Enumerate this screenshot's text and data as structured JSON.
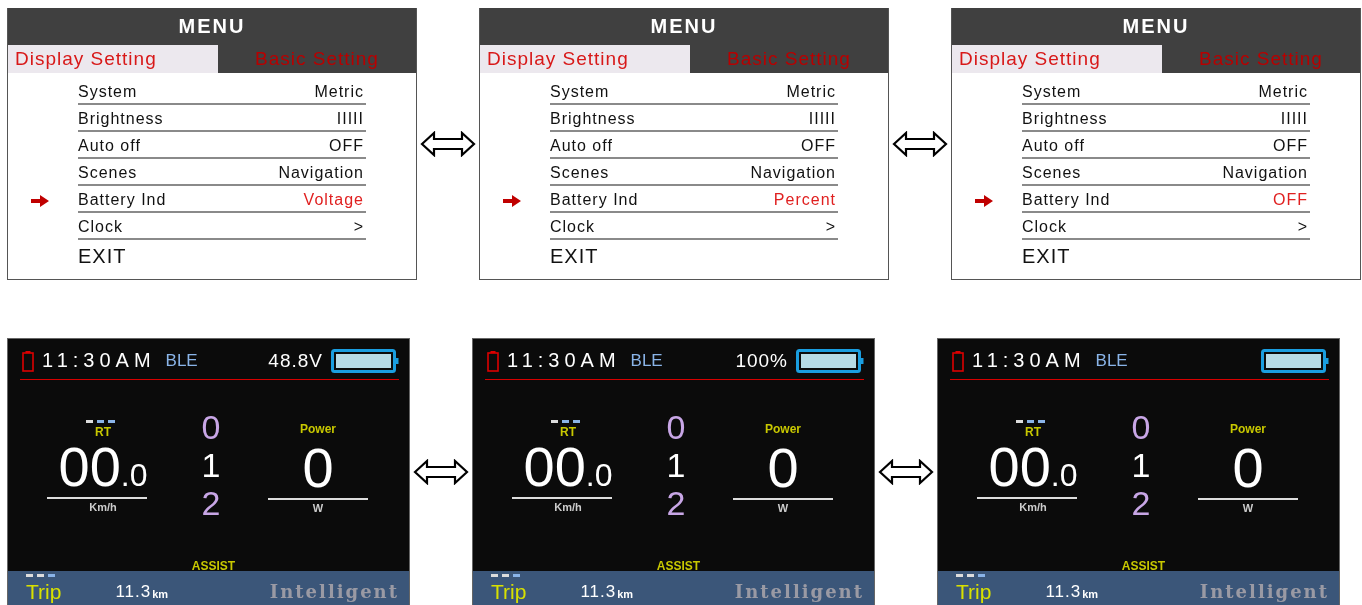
{
  "menus": [
    {
      "title": "MENU",
      "tabs": [
        {
          "label": "Display Setting",
          "selected": true
        },
        {
          "label": "Basic Setting",
          "selected": false
        }
      ],
      "items": [
        {
          "label": "System",
          "value": "Metric",
          "selected": false
        },
        {
          "label": "Brightness",
          "value": "IIIII",
          "selected": false
        },
        {
          "label": "Auto off",
          "value": "OFF",
          "selected": false
        },
        {
          "label": "Scenes",
          "value": "Navigation",
          "selected": false
        },
        {
          "label": "Battery Ind",
          "value": "Voltage",
          "selected": true
        },
        {
          "label": "Clock",
          "value": ">",
          "selected": false
        }
      ],
      "exit": "EXIT"
    },
    {
      "title": "MENU",
      "tabs": [
        {
          "label": "Display Setting",
          "selected": true
        },
        {
          "label": "Basic Setting",
          "selected": false
        }
      ],
      "items": [
        {
          "label": "System",
          "value": "Metric",
          "selected": false
        },
        {
          "label": "Brightness",
          "value": "IIIII",
          "selected": false
        },
        {
          "label": "Auto off",
          "value": "OFF",
          "selected": false
        },
        {
          "label": "Scenes",
          "value": "Navigation",
          "selected": false
        },
        {
          "label": "Battery Ind",
          "value": "Percent",
          "selected": true
        },
        {
          "label": "Clock",
          "value": ">",
          "selected": false
        }
      ],
      "exit": "EXIT"
    },
    {
      "title": "MENU",
      "tabs": [
        {
          "label": "Display Setting",
          "selected": true
        },
        {
          "label": "Basic Setting",
          "selected": false
        }
      ],
      "items": [
        {
          "label": "System",
          "value": "Metric",
          "selected": false
        },
        {
          "label": "Brightness",
          "value": "IIIII",
          "selected": false
        },
        {
          "label": "Auto off",
          "value": "OFF",
          "selected": false
        },
        {
          "label": "Scenes",
          "value": "Navigation",
          "selected": false
        },
        {
          "label": "Battery Ind",
          "value": "OFF",
          "selected": true
        },
        {
          "label": "Clock",
          "value": ">",
          "selected": false
        }
      ],
      "exit": "EXIT"
    }
  ],
  "dashboards": [
    {
      "clock": "11:30AM",
      "ble": "BLE",
      "battery_reading": "48.8V",
      "rt_label": "RT",
      "speed": "00",
      "speed_decimal": ".0",
      "speed_unit": "Km/h",
      "assist_levels": [
        {
          "label": "0",
          "selected": false
        },
        {
          "label": "1",
          "selected": true
        },
        {
          "label": "2",
          "selected": false
        }
      ],
      "power_label": "Power",
      "power": "0",
      "power_unit": "W",
      "assist_label": "ASSIST",
      "trip_label": "Trip",
      "trip_value": "11.3",
      "trip_unit": "km",
      "mode": "Intelligent"
    },
    {
      "clock": "11:30AM",
      "ble": "BLE",
      "battery_reading": "100%",
      "rt_label": "RT",
      "speed": "00",
      "speed_decimal": ".0",
      "speed_unit": "Km/h",
      "assist_levels": [
        {
          "label": "0",
          "selected": false
        },
        {
          "label": "1",
          "selected": true
        },
        {
          "label": "2",
          "selected": false
        }
      ],
      "power_label": "Power",
      "power": "0",
      "power_unit": "W",
      "assist_label": "ASSIST",
      "trip_label": "Trip",
      "trip_value": "11.3",
      "trip_unit": "km",
      "mode": "Intelligent"
    },
    {
      "clock": "11:30AM",
      "ble": "BLE",
      "rt_label": "RT",
      "speed": "00",
      "speed_decimal": ".0",
      "speed_unit": "Km/h",
      "assist_levels": [
        {
          "label": "0",
          "selected": false
        },
        {
          "label": "1",
          "selected": true
        },
        {
          "label": "2",
          "selected": false
        }
      ],
      "power_label": "Power",
      "power": "0",
      "power_unit": "W",
      "assist_label": "ASSIST",
      "trip_label": "Trip",
      "trip_value": "11.3",
      "trip_unit": "km",
      "mode": "Intelligent"
    }
  ]
}
